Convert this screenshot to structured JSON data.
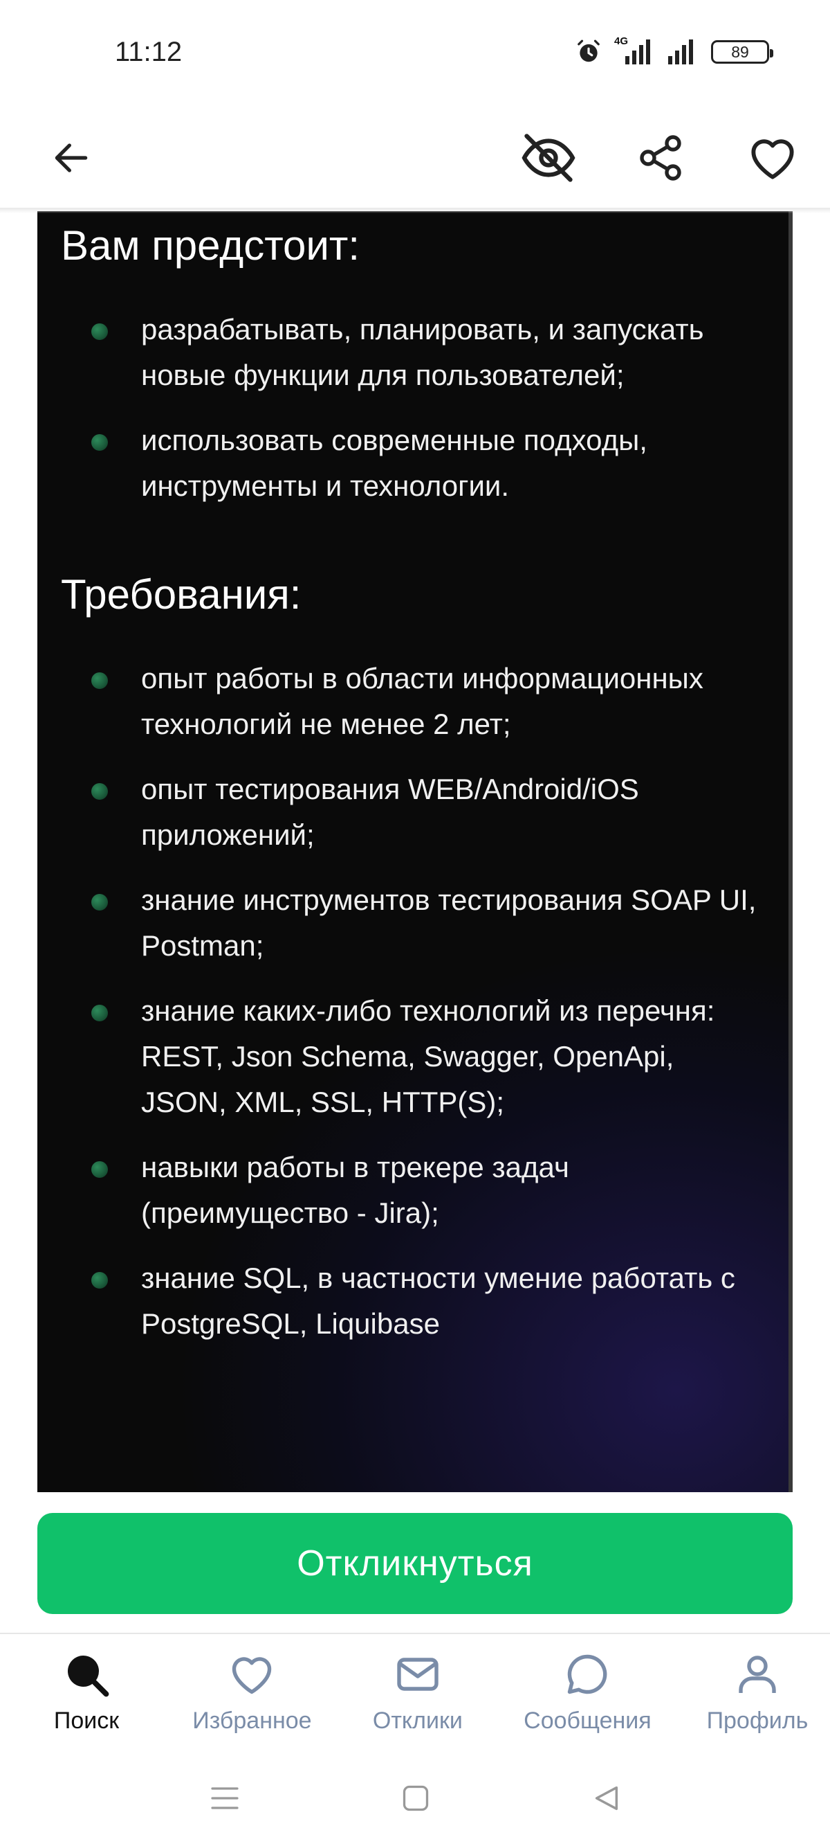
{
  "status_bar": {
    "time": "11:12",
    "network": "4G",
    "battery": "89"
  },
  "toolbar": {
    "back_icon": "arrow-left-icon",
    "hide_icon": "eye-off-icon",
    "share_icon": "share-icon",
    "favorite_icon": "heart-icon"
  },
  "content": {
    "section1_title": "Вам предстоит:",
    "section1_items": [
      "разрабатывать, планировать, и запускать новые функции для пользователей;",
      "использовать современные подходы, инструменты и технологии."
    ],
    "section2_title": "Требования:",
    "section2_items": [
      "опыт работы в области информационных технологий не менее 2 лет;",
      "опыт тестирования WEB/Android/iOS приложений;",
      "знание инструментов тестирования SOAP UI, Postman;",
      "знание каких-либо технологий из перечня: REST, Json Schema, Swagger, OpenApi, JSON, XML, SSL, HTTP(S);",
      "навыки работы в трекере задач (преимущество - Jira);",
      "знание SQL, в частности умение работать с PostgreSQL, Liquibase"
    ]
  },
  "respond_button": {
    "label": "Откликнуться",
    "color": "#10c16a"
  },
  "bottom_nav": {
    "items": [
      {
        "label": "Поиск",
        "icon": "search-icon",
        "active": true
      },
      {
        "label": "Избранное",
        "icon": "heart-icon",
        "active": false
      },
      {
        "label": "Отклики",
        "icon": "mail-icon",
        "active": false
      },
      {
        "label": "Сообщения",
        "icon": "chat-bubble-icon",
        "active": false
      },
      {
        "label": "Профиль",
        "icon": "user-icon",
        "active": false
      }
    ],
    "inactive_color": "#7a8ca8",
    "active_color": "#111111"
  }
}
